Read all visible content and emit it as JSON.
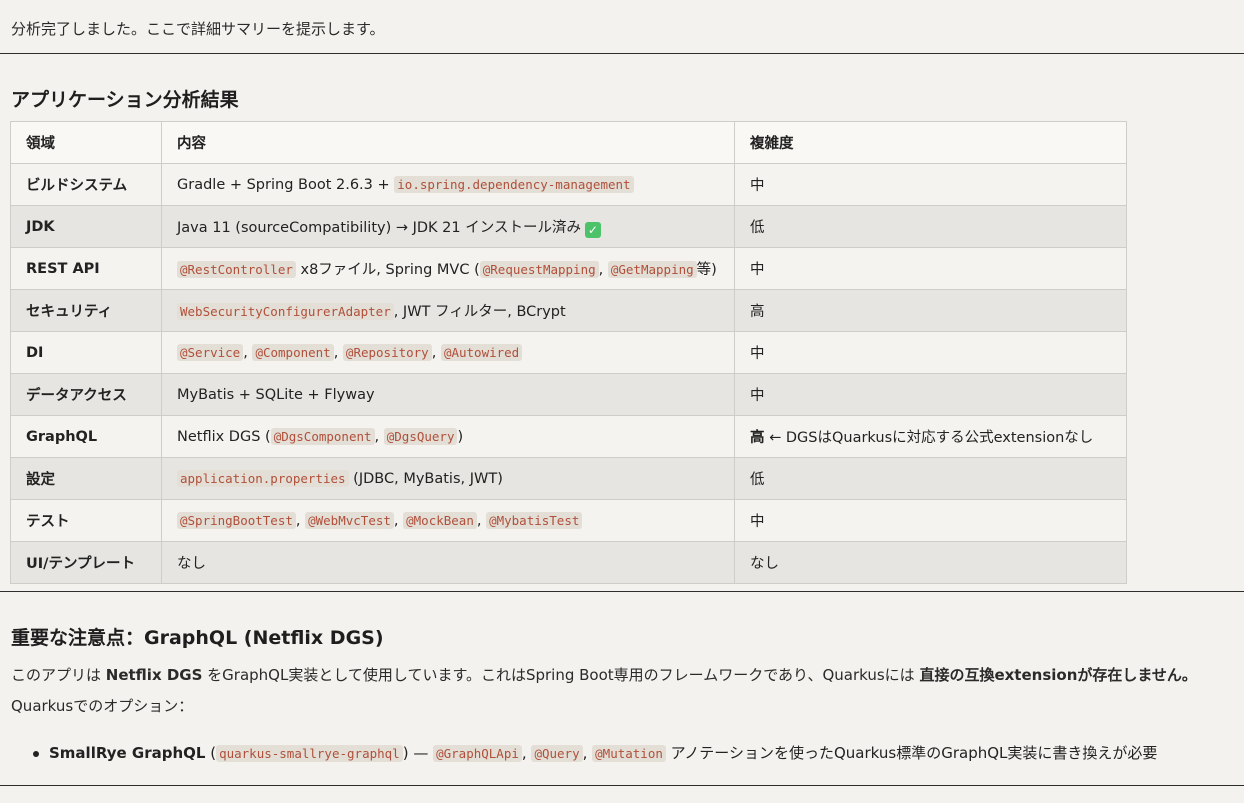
{
  "intro_text": "分析完了しました。ここで詳細サマリーを提示します。",
  "section1_title": "アプリケーション分析結果",
  "table": {
    "headers": [
      "領域",
      "内容",
      "複雑度"
    ],
    "rows": [
      {
        "area": "ビルドシステム",
        "content": [
          {
            "type": "text",
            "value": "Gradle + Spring Boot 2.6.3 + "
          },
          {
            "type": "code",
            "value": "io.spring.dependency-management"
          }
        ],
        "complexity": [
          {
            "type": "text",
            "value": "中"
          }
        ]
      },
      {
        "area": "JDK",
        "content": [
          {
            "type": "text",
            "value": "Java 11 (sourceCompatibility) → JDK 21 インストール済み"
          },
          {
            "type": "icon",
            "value": "check-icon",
            "glyph": "✓"
          }
        ],
        "complexity": [
          {
            "type": "text",
            "value": "低"
          }
        ]
      },
      {
        "area": "REST API",
        "content": [
          {
            "type": "code",
            "value": "@RestController"
          },
          {
            "type": "text",
            "value": " x8ファイル, Spring MVC ("
          },
          {
            "type": "code",
            "value": "@RequestMapping"
          },
          {
            "type": "text",
            "value": ", "
          },
          {
            "type": "code",
            "value": "@GetMapping"
          },
          {
            "type": "text",
            "value": "等)"
          }
        ],
        "complexity": [
          {
            "type": "text",
            "value": "中"
          }
        ]
      },
      {
        "area": "セキュリティ",
        "content": [
          {
            "type": "code",
            "value": "WebSecurityConfigurerAdapter"
          },
          {
            "type": "text",
            "value": ", JWT フィルター, BCrypt"
          }
        ],
        "complexity": [
          {
            "type": "text",
            "value": "高"
          }
        ]
      },
      {
        "area": "DI",
        "content": [
          {
            "type": "code",
            "value": "@Service"
          },
          {
            "type": "text",
            "value": ", "
          },
          {
            "type": "code",
            "value": "@Component"
          },
          {
            "type": "text",
            "value": ", "
          },
          {
            "type": "code",
            "value": "@Repository"
          },
          {
            "type": "text",
            "value": ", "
          },
          {
            "type": "code",
            "value": "@Autowired"
          }
        ],
        "complexity": [
          {
            "type": "text",
            "value": "中"
          }
        ]
      },
      {
        "area": "データアクセス",
        "content": [
          {
            "type": "text",
            "value": "MyBatis + SQLite + Flyway"
          }
        ],
        "complexity": [
          {
            "type": "text",
            "value": "中"
          }
        ]
      },
      {
        "area": "GraphQL",
        "content": [
          {
            "type": "text",
            "value": "Netflix DGS ("
          },
          {
            "type": "code",
            "value": "@DgsComponent"
          },
          {
            "type": "text",
            "value": ", "
          },
          {
            "type": "code",
            "value": "@DgsQuery"
          },
          {
            "type": "text",
            "value": ")"
          }
        ],
        "complexity": [
          {
            "type": "bold",
            "value": "高"
          },
          {
            "type": "text",
            "value": " ← DGSはQuarkusに対応する公式extensionなし"
          }
        ]
      },
      {
        "area": "設定",
        "content": [
          {
            "type": "code",
            "value": "application.properties"
          },
          {
            "type": "text",
            "value": " (JDBC, MyBatis, JWT)"
          }
        ],
        "complexity": [
          {
            "type": "text",
            "value": "低"
          }
        ]
      },
      {
        "area": "テスト",
        "content": [
          {
            "type": "code",
            "value": "@SpringBootTest"
          },
          {
            "type": "text",
            "value": ", "
          },
          {
            "type": "code",
            "value": "@WebMvcTest"
          },
          {
            "type": "text",
            "value": ", "
          },
          {
            "type": "code",
            "value": "@MockBean"
          },
          {
            "type": "text",
            "value": ", "
          },
          {
            "type": "code",
            "value": "@MybatisTest"
          }
        ],
        "complexity": [
          {
            "type": "text",
            "value": "中"
          }
        ]
      },
      {
        "area": "UI/テンプレート",
        "content": [
          {
            "type": "text",
            "value": "なし"
          }
        ],
        "complexity": [
          {
            "type": "text",
            "value": "なし"
          }
        ]
      }
    ]
  },
  "section2_title": "重要な注意点：GraphQL (Netflix DGS)",
  "paragraph1": [
    {
      "type": "text",
      "value": "このアプリは "
    },
    {
      "type": "bold",
      "value": "Netflix DGS"
    },
    {
      "type": "text",
      "value": " をGraphQL実装として使用しています。これはSpring Boot専用のフレームワークであり、Quarkusには "
    },
    {
      "type": "bold",
      "value": "直接の互換extensionが存在しません。"
    }
  ],
  "paragraph2": "Quarkusでのオプション：",
  "bullets": [
    [
      {
        "type": "bold",
        "value": "SmallRye GraphQL"
      },
      {
        "type": "text",
        "value": " ("
      },
      {
        "type": "code",
        "value": "quarkus-smallrye-graphql"
      },
      {
        "type": "text",
        "value": ") — "
      },
      {
        "type": "code",
        "value": "@GraphQLApi"
      },
      {
        "type": "text",
        "value": ", "
      },
      {
        "type": "code",
        "value": "@Query"
      },
      {
        "type": "text",
        "value": ", "
      },
      {
        "type": "code",
        "value": "@Mutation"
      },
      {
        "type": "text",
        "value": " アノテーションを使ったQuarkus標準のGraphQL実装に書き換えが必要"
      }
    ]
  ],
  "colors": {
    "background": "#f4f2ee",
    "code_text": "#b0503a",
    "code_bg": "#e3ded6",
    "check": "#4cc36a"
  }
}
